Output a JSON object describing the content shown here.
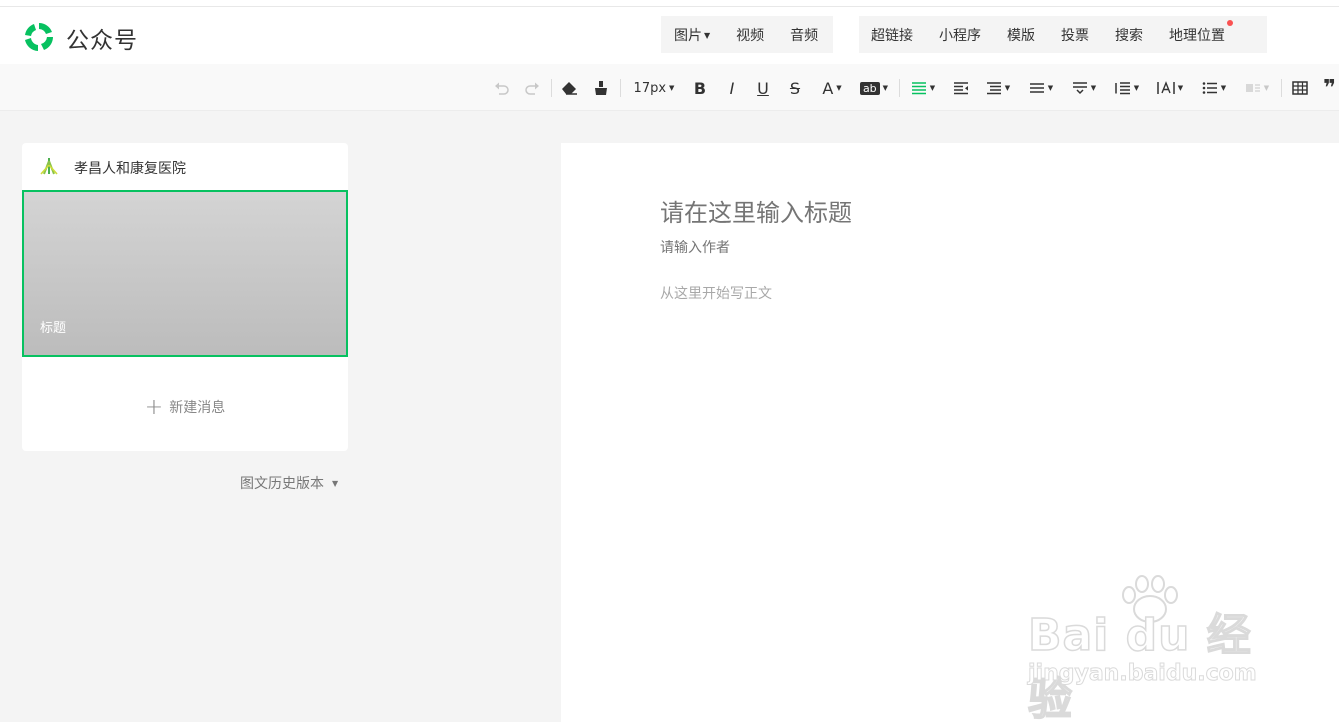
{
  "app": {
    "brand": "公众号",
    "brand_color": "#07c160"
  },
  "insert_menu": {
    "media": [
      {
        "label": "图片",
        "dropdown": true
      },
      {
        "label": "视频"
      },
      {
        "label": "音频"
      }
    ],
    "components": [
      {
        "label": "超链接"
      },
      {
        "label": "小程序"
      },
      {
        "label": "模版"
      },
      {
        "label": "投票"
      },
      {
        "label": "搜索"
      },
      {
        "label": "地理位置",
        "has_dot": true
      }
    ]
  },
  "toolbar": {
    "font_size": "17px",
    "bold": "B",
    "italic": "I",
    "underline": "U",
    "strike": "S",
    "font_color": "A",
    "bg_color": "ab",
    "quote_icon": "❞"
  },
  "sidebar": {
    "account_name": "孝昌人和康复医院",
    "article_card": {
      "title": "标题"
    },
    "new_message_label": "新建消息",
    "history_label": "图文历史版本"
  },
  "editor": {
    "title_placeholder": "请在这里输入标题",
    "author_placeholder": "请输入作者",
    "body_placeholder": "从这里开始写正文"
  },
  "watermark": {
    "brand": "Bai du 经验",
    "url": "jingyan.baidu.com"
  }
}
